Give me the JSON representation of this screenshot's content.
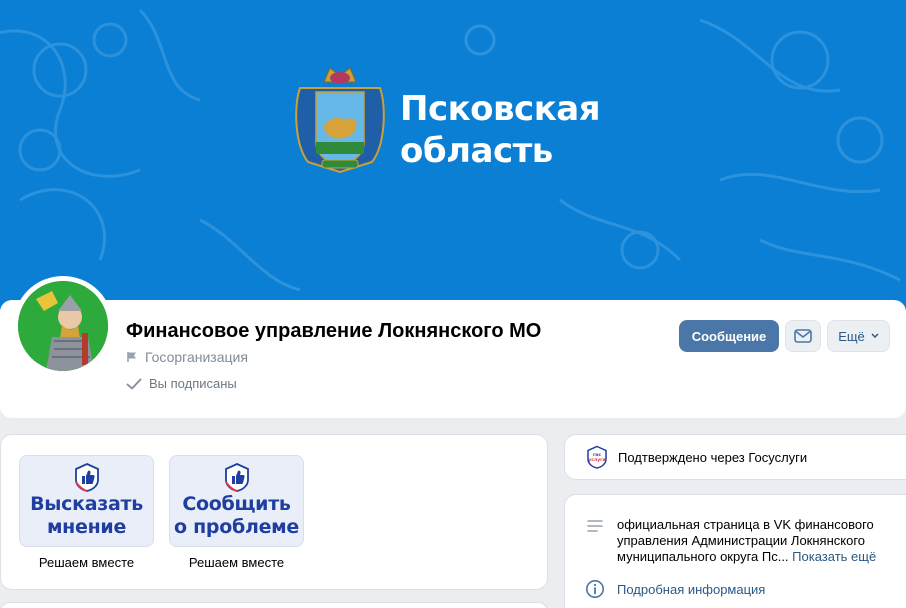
{
  "cover": {
    "title_line1": "Псковская",
    "title_line2": "область",
    "background": "#0a7fd4"
  },
  "group": {
    "name": "Финансовое управление Локнянского МО",
    "type": "Госорганизация",
    "subscribed": "Вы подписаны"
  },
  "actions": {
    "message": "Сообщение",
    "more": "Ещё",
    "accent": "#4a76a8"
  },
  "widgets": [
    {
      "icon": "gosuslugi-like-icon",
      "line1": "Высказать",
      "line2": "мнение",
      "caption": "Решаем вместе"
    },
    {
      "icon": "gosuslugi-like-icon",
      "line1": "Сообщить",
      "line2": "о проблеме",
      "caption": "Решаем вместе"
    }
  ],
  "verified": {
    "icon": "gosuslugi-badge-icon",
    "text": "Подтверждено через Госуслуги"
  },
  "about": {
    "description": "официальная страница в VK финансового управления Администрации Локнянского муниципального округа Пс...",
    "show_more": "Показать ещё",
    "details": "Подробная информация"
  }
}
